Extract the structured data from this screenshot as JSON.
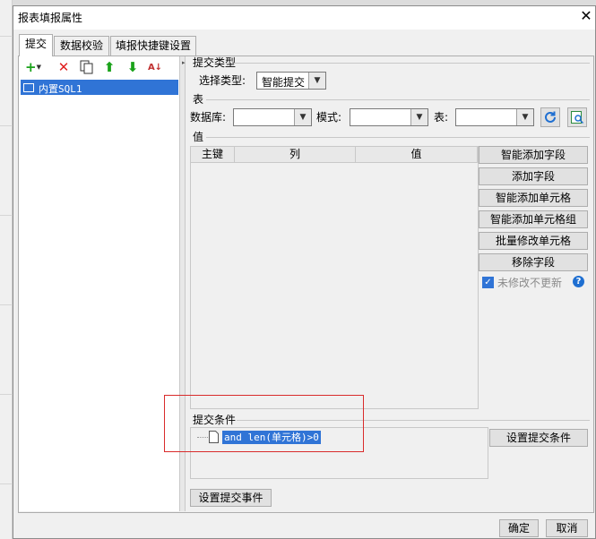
{
  "dialog": {
    "title": "报表填报属性",
    "close_glyph": "✕"
  },
  "tabs": [
    {
      "label": "提交"
    },
    {
      "label": "数据校验"
    },
    {
      "label": "填报快捷键设置"
    }
  ],
  "toolbar": {
    "add_icon": "plus-icon",
    "delete_icon": "delete-x-icon",
    "copy_icon": "copy-icon",
    "up_icon": "arrow-up-icon",
    "down_icon": "arrow-down-icon",
    "sort_icon": "sort-az-icon",
    "add_glyph": "+",
    "delete_glyph": "✕",
    "up_glyph": "⬆",
    "down_glyph": "⬇",
    "sort_glyph": "A↓",
    "colors": {
      "green": "#1aa21a",
      "red": "#e02020"
    }
  },
  "tree": {
    "items": [
      {
        "label": "内置SQL1"
      }
    ]
  },
  "submit_type": {
    "group_label": "提交类型",
    "select_label": "选择类型:",
    "select_value": "智能提交"
  },
  "table_group": {
    "group_label": "表",
    "database_label": "数据库:",
    "schema_label": "模式:",
    "table_label": "表:",
    "database_value": "",
    "schema_value": "",
    "table_value": ""
  },
  "values_group": {
    "group_label": "值",
    "columns": [
      "主键",
      "列",
      "值"
    ],
    "rows": []
  },
  "side_buttons": {
    "smart_add_field": "智能添加字段",
    "add_field": "添加字段",
    "smart_add_cell": "智能添加单元格",
    "smart_add_cell_group": "智能添加单元格组",
    "batch_modify_cell": "批量修改单元格",
    "remove_field": "移除字段"
  },
  "no_update_checkbox": {
    "label": "未修改不更新",
    "checked": true,
    "help_glyph": "?"
  },
  "condition": {
    "group_label": "提交条件",
    "text": "and len(单元格)>0",
    "set_button": "设置提交条件"
  },
  "events": {
    "button": "设置提交事件"
  },
  "footer": {
    "ok": "确定",
    "cancel": "取消"
  },
  "colors": {
    "selection": "#3074d6",
    "highlight_box": "#d92b2b",
    "check": "#3074d6"
  }
}
